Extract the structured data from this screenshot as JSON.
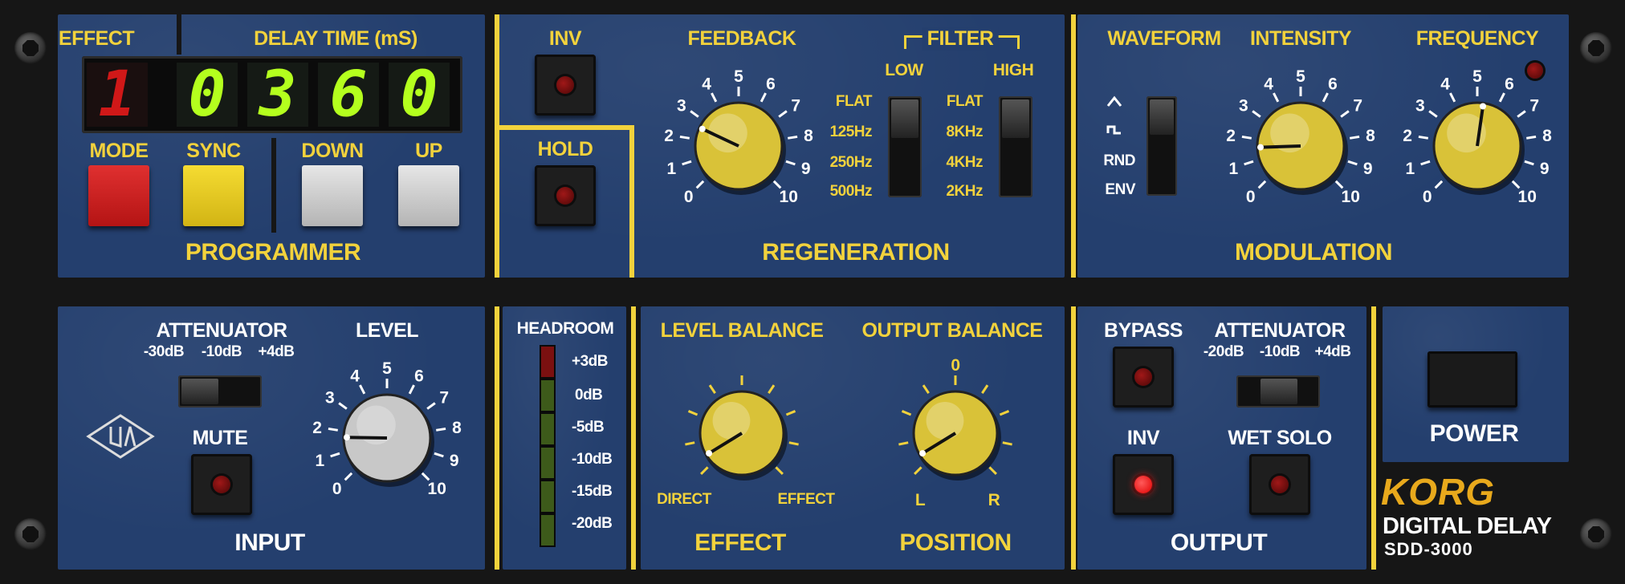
{
  "colors": {
    "panel": "#243f6e",
    "label": "#f2d23c",
    "display_digit": "#b4ff1e",
    "effect_digit": "#d01818",
    "knob_gold": "#d9c238",
    "knob_silver": "#c8c8c8"
  },
  "programmer": {
    "effect_label": "EFFECT",
    "delay_time_label": "DELAY TIME  (mS)",
    "effect_digit": "1",
    "delay_digits": [
      "0",
      "3",
      "6",
      "0"
    ],
    "buttons": {
      "mode": "MODE",
      "sync": "SYNC",
      "down": "DOWN",
      "up": "UP"
    },
    "title": "PROGRAMMER"
  },
  "center_top": {
    "inv": "INV",
    "hold": "HOLD"
  },
  "regeneration": {
    "feedback": "FEEDBACK",
    "filter": "FILTER",
    "low": "LOW",
    "high": "HIGH",
    "low_options": [
      "FLAT",
      "125Hz",
      "250Hz",
      "500Hz"
    ],
    "high_options": [
      "FLAT",
      "8KHz",
      "4KHz",
      "2KHz"
    ],
    "title": "REGENERATION"
  },
  "modulation": {
    "waveform": "WAVEFORM",
    "intensity": "INTENSITY",
    "frequency": "FREQUENCY",
    "waveform_options": [
      "RND",
      "ENV"
    ],
    "title": "MODULATION"
  },
  "knob_scale": [
    "0",
    "1",
    "2",
    "3",
    "4",
    "5",
    "6",
    "7",
    "8",
    "9",
    "10"
  ],
  "input": {
    "attenuator": "ATTENUATOR",
    "att_options": [
      "-30dB",
      "-10dB",
      "+4dB"
    ],
    "level": "LEVEL",
    "mute": "MUTE",
    "title": "INPUT"
  },
  "headroom": {
    "title": "HEADROOM",
    "levels": [
      "+3dB",
      "0dB",
      "-5dB",
      "-10dB",
      "-15dB",
      "-20dB"
    ]
  },
  "effect": {
    "level_balance": "LEVEL  BALANCE",
    "direct": "DIRECT",
    "effect_end": "EFFECT",
    "title": "EFFECT"
  },
  "position": {
    "output_balance": "OUTPUT BALANCE",
    "zero": "0",
    "left": "L",
    "right": "R",
    "title": "POSITION"
  },
  "output": {
    "bypass": "BYPASS",
    "attenuator": "ATTENUATOR",
    "att_options": [
      "-20dB",
      "-10dB",
      "+4dB"
    ],
    "inv": "INV",
    "wet_solo": "WET SOLO",
    "title": "OUTPUT"
  },
  "power": {
    "label": "POWER"
  },
  "brand": {
    "korg": "KORG",
    "product": "DIGITAL DELAY",
    "model": "SDD-3000"
  },
  "knobs": {
    "feedback": 2.6,
    "intensity": 1.6,
    "frequency": 5.3,
    "level": 1.7,
    "level_balance": 0.5,
    "output_balance": 0.5
  }
}
